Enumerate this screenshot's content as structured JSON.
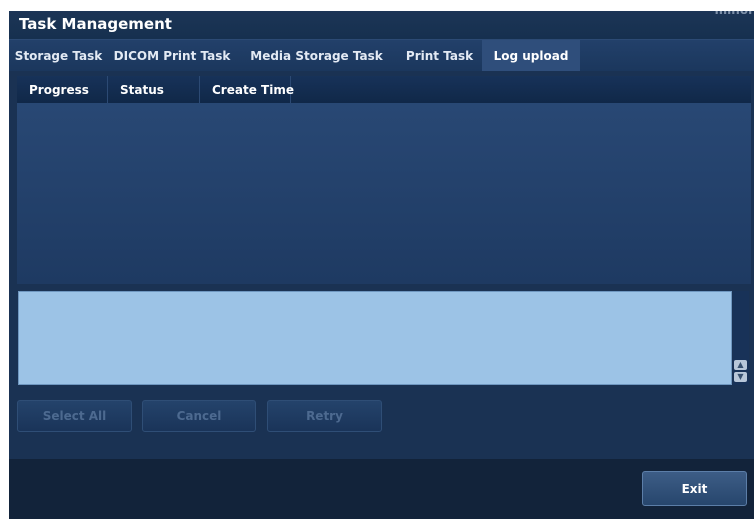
{
  "window": {
    "title": "Task Management",
    "corner_fragment": "minor"
  },
  "tabs": [
    {
      "label": "Storage Task",
      "active": false
    },
    {
      "label": "DICOM Print Task",
      "active": false
    },
    {
      "label": "Media Storage Task",
      "active": false
    },
    {
      "label": "Print Task",
      "active": false
    },
    {
      "label": "Log upload",
      "active": true
    }
  ],
  "table": {
    "columns": [
      "Progress",
      "Status",
      "Create Time"
    ],
    "rows": []
  },
  "message_box": {
    "text": ""
  },
  "actions": {
    "select_all": "Select All",
    "cancel": "Cancel",
    "retry": "Retry",
    "exit": "Exit"
  },
  "icons": {
    "scroll_up": "scroll-up-arrow-icon",
    "scroll_down": "scroll-down-arrow-icon"
  },
  "colors": {
    "panel_bg": "#1a3253",
    "active_tab": "#2f4e7b",
    "message_bg": "#9cc3e6",
    "footer_bg": "#12233a"
  }
}
